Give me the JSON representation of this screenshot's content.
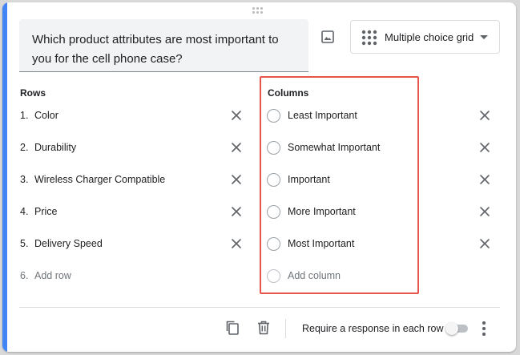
{
  "question": {
    "text": "Which product attributes are most important to you for the cell phone case?"
  },
  "question_type": {
    "selected": "Multiple choice grid",
    "icon": "grid-icon"
  },
  "rows": {
    "title": "Rows",
    "items": [
      {
        "num": "1.",
        "label": "Color"
      },
      {
        "num": "2.",
        "label": "Durability"
      },
      {
        "num": "3.",
        "label": "Wireless Charger Compatible"
      },
      {
        "num": "4.",
        "label": "Price"
      },
      {
        "num": "5.",
        "label": "Delivery Speed"
      }
    ],
    "add": {
      "num": "6.",
      "label": "Add row"
    }
  },
  "columns": {
    "title": "Columns",
    "items": [
      {
        "label": "Least Important"
      },
      {
        "label": "Somewhat Important"
      },
      {
        "label": "Important"
      },
      {
        "label": "More Important"
      },
      {
        "label": "Most Important"
      }
    ],
    "add": {
      "label": "Add column"
    }
  },
  "footer": {
    "require_label": "Require a response in each row",
    "require_enabled": false
  },
  "colors": {
    "accent": "#4285f4",
    "highlight": "#e8534a"
  }
}
